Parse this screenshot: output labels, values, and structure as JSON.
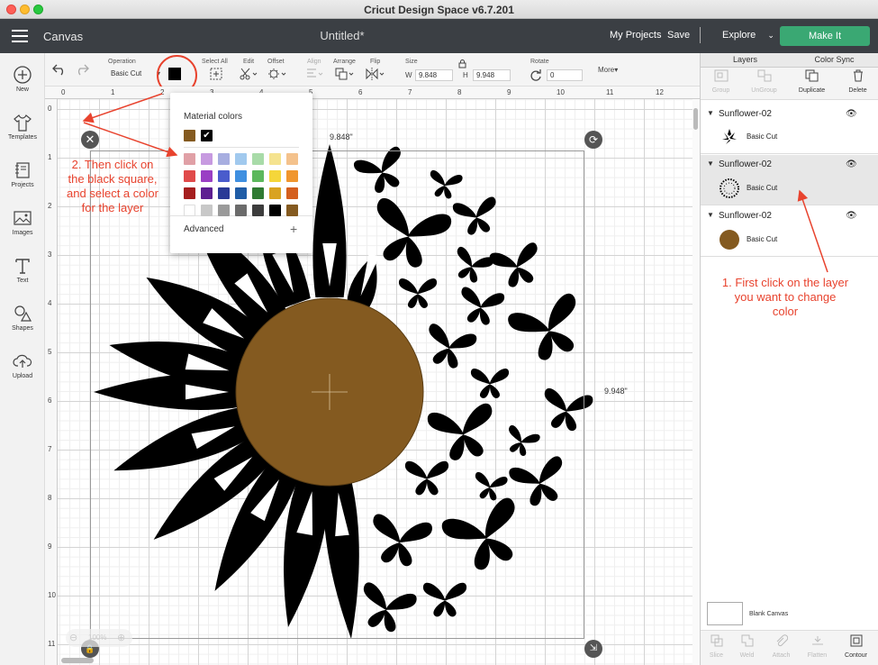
{
  "window": {
    "title": "Cricut Design Space  v6.7.201"
  },
  "header": {
    "section": "Canvas",
    "doc_title": "Untitled*",
    "my_projects": "My Projects",
    "save": "Save",
    "separator": "|",
    "explore": "Explore",
    "make_it": "Make It"
  },
  "toolbar": {
    "operation_label": "Operation",
    "operation_value": "Basic Cut",
    "select_all": "Select All",
    "edit": "Edit",
    "offset": "Offset",
    "align": "Align",
    "arrange": "Arrange",
    "flip": "Flip",
    "size_label": "Size",
    "w_label": "W",
    "w_value": "9.848",
    "h_label": "H",
    "h_value": "9.948",
    "rotate_label": "Rotate",
    "rotate_value": "0",
    "more": "More",
    "swatch_color": "#000000"
  },
  "sidebar": {
    "items": [
      {
        "label": "New",
        "icon": "plus-circle-icon"
      },
      {
        "label": "Templates",
        "icon": "tshirt-icon"
      },
      {
        "label": "Projects",
        "icon": "notebook-icon"
      },
      {
        "label": "Images",
        "icon": "image-icon"
      },
      {
        "label": "Text",
        "icon": "text-t-icon"
      },
      {
        "label": "Shapes",
        "icon": "shapes-icon"
      },
      {
        "label": "Upload",
        "icon": "cloud-upload-icon"
      }
    ]
  },
  "ruler": {
    "top": [
      "0",
      "1",
      "2",
      "3",
      "4",
      "5",
      "6",
      "7",
      "8",
      "9",
      "10",
      "11",
      "12"
    ],
    "left": [
      "0",
      "1",
      "2",
      "3",
      "4",
      "5",
      "6",
      "7",
      "8",
      "9",
      "10",
      "11"
    ]
  },
  "canvas": {
    "width_label": "9.848\"",
    "height_label": "9.948\"",
    "zoom": "100%",
    "center_color": "#845a20",
    "artwork_color": "#000000"
  },
  "popup": {
    "title": "Material colors",
    "advanced": "Advanced",
    "plus": "+",
    "recent": [
      "#845a20",
      "#000000"
    ],
    "palette": [
      [
        "#e0a0a6",
        "#c79ae0",
        "#a7aee0",
        "#a1c9ee",
        "#a8dba8",
        "#f5e38f",
        "#f4c28c"
      ],
      [
        "#e04a4a",
        "#9a3fc4",
        "#4a5ccc",
        "#3f8fe0",
        "#5cb85c",
        "#f5d63a",
        "#f0962e"
      ],
      [
        "#a51e1e",
        "#5d1e91",
        "#2a3a96",
        "#1f5ca6",
        "#2f7a32",
        "#d9a321",
        "#d45f1e"
      ],
      [
        "#ffffff",
        "#c8c8c8",
        "#9a9a9a",
        "#6b6b6b",
        "#3c3c3c",
        "#000000",
        "#845a20"
      ]
    ]
  },
  "right_panel": {
    "tabs": [
      "Layers",
      "Color Sync"
    ],
    "tools": [
      "Group",
      "UnGroup",
      "Duplicate",
      "Delete"
    ],
    "layers": [
      {
        "name": "Sunflower-02",
        "operation": "Basic Cut"
      },
      {
        "name": "Sunflower-02",
        "operation": "Basic Cut"
      },
      {
        "name": "Sunflower-02",
        "operation": "Basic Cut"
      }
    ],
    "blank_canvas": "Blank Canvas",
    "bottom_tools": [
      "Slice",
      "Weld",
      "Attach",
      "Flatten",
      "Contour"
    ]
  },
  "annotations": {
    "step1": "1. First click on the layer you want to change color",
    "step2": "2. Then click on the black square, and select a color for the layer",
    "color": "#e8432e"
  }
}
